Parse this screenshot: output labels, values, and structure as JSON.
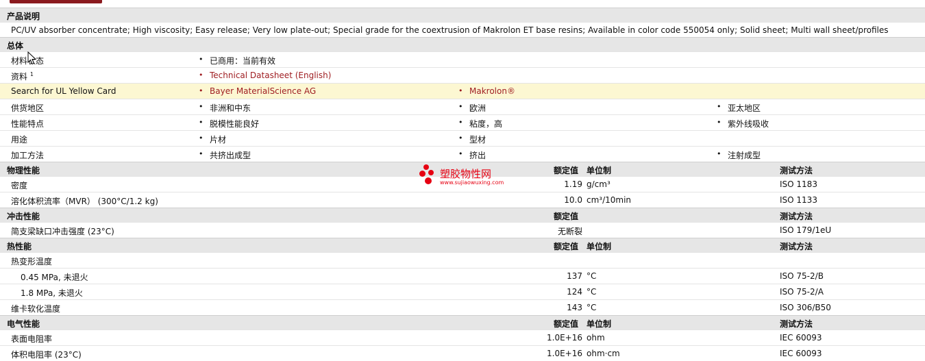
{
  "description": {
    "header": "产品说明",
    "text": "PC/UV absorber concentrate; High viscosity; Easy release; Very low plate-out; Special grade for the coextrusion of Makrolon ET base resins; Available in color code 550054 only; Solid sheet; Multi wall sheet/profiles"
  },
  "general": {
    "header": "总体",
    "rows": [
      {
        "label": "材料状态",
        "items": [
          "已商用：当前有效"
        ]
      },
      {
        "label": "资料",
        "sup": "1",
        "items": [
          "Technical Datasheet (English)"
        ]
      },
      {
        "label": "Search for UL Yellow Card",
        "items": [
          "Bayer MaterialScience AG",
          "Makrolon®"
        ]
      },
      {
        "label": "供货地区",
        "items": [
          "非洲和中东",
          "欧洲",
          "亚太地区"
        ]
      },
      {
        "label": "性能特点",
        "items": [
          "脱模性能良好",
          "粘度，高",
          "紫外线吸收"
        ]
      },
      {
        "label": "用途",
        "items": [
          "片材",
          "型材"
        ]
      },
      {
        "label": "加工方法",
        "items": [
          "共挤出成型",
          "挤出",
          "注射成型"
        ]
      }
    ]
  },
  "columns": {
    "value": "额定值",
    "unit": "单位制",
    "method": "测试方法"
  },
  "physical": {
    "header": "物理性能",
    "rows": [
      {
        "label": "密度",
        "value": "1.19",
        "unit": "g/cm³",
        "method": "ISO 1183"
      },
      {
        "label": "溶化体积流率（MVR） (300°C/1.2 kg)",
        "value": "10.0",
        "unit": "cm³/10min",
        "method": "ISO 1133"
      }
    ]
  },
  "impact": {
    "header": "冲击性能",
    "rows": [
      {
        "label": "简支梁缺口冲击强度 (23°C)",
        "value": "无断裂",
        "unit": "",
        "method": "ISO 179/1eU"
      }
    ]
  },
  "thermal": {
    "header": "热性能",
    "rows": [
      {
        "label": "热变形温度",
        "value": "",
        "unit": "",
        "method": ""
      },
      {
        "label": "0.45 MPa, 未退火",
        "value": "137",
        "unit": "°C",
        "method": "ISO 75-2/B"
      },
      {
        "label": "1.8 MPa, 未退火",
        "value": "124",
        "unit": "°C",
        "method": "ISO 75-2/A"
      },
      {
        "label": "维卡软化温度",
        "value": "143",
        "unit": "°C",
        "method": "ISO 306/B50"
      }
    ]
  },
  "electrical": {
    "header": "电气性能",
    "rows": [
      {
        "label": "表面电阻率",
        "value": "1.0E+16",
        "unit": "ohm",
        "method": "IEC 60093"
      },
      {
        "label": "体积电阻率 (23°C)",
        "value": "1.0E+16",
        "unit": "ohm·cm",
        "method": "IEC 60093"
      }
    ]
  },
  "watermark": {
    "name": "塑胶物性网",
    "url": "www.sujiaowuxing.com"
  },
  "colors": {
    "accent": "#8b1a1f",
    "link": "#9e1b1f",
    "section_bg": "#e6e6e6",
    "highlight_bg": "#fcf7d2",
    "watermark": "#e60012"
  }
}
